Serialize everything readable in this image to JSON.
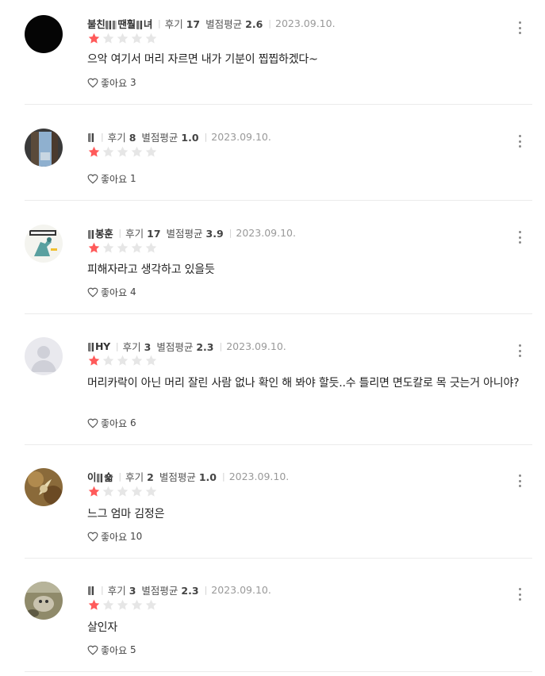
{
  "labels": {
    "review_count_prefix": "후기",
    "rating_avg_prefix": "별점평균",
    "like_prefix": "좋아요"
  },
  "colors": {
    "star_filled": "#ff5a5a",
    "star_empty": "#e6e6e6"
  },
  "reviews": [
    {
      "nickname": "불친",
      "nickname_tail": "땐훨",
      "nickname_end": "녀",
      "review_count": "17",
      "rating_avg": "2.6",
      "date": "2023.09.10.",
      "stars": 1,
      "content": "으악 여기서 머리 자르면 내가 기분이 찝찝하겠다~",
      "likes": "3",
      "avatar": "black-avatar"
    },
    {
      "nickname": "",
      "nickname_tail": "",
      "nickname_end": "",
      "review_count": "8",
      "rating_avg": "1.0",
      "date": "2023.09.10.",
      "stars": 1,
      "content": "",
      "likes": "1",
      "avatar": "window-photo-avatar"
    },
    {
      "nickname": "",
      "nickname_tail": "봉훈",
      "nickname_end": "",
      "review_count": "17",
      "rating_avg": "3.9",
      "date": "2023.09.10.",
      "stars": 1,
      "content": "피해자라고 생각하고 있을듯",
      "likes": "4",
      "avatar": "cartoon-avatar"
    },
    {
      "nickname": "",
      "nickname_tail": "HY",
      "nickname_end": "",
      "review_count": "3",
      "rating_avg": "2.3",
      "date": "2023.09.10.",
      "stars": 1,
      "content": "머리카락이 아닌 머리 잘린 사람 없나 확인 해 봐야 할듯..수 틀리면 면도칼로 목 긋는거 아니야?",
      "likes": "6",
      "avatar": "default-avatar"
    },
    {
      "nickname": "이",
      "nickname_tail": "숇",
      "nickname_end": "",
      "review_count": "2",
      "rating_avg": "1.0",
      "date": "2023.09.10.",
      "stars": 1,
      "content": "느그 엄마 김정은",
      "likes": "10",
      "avatar": "plant-photo-avatar"
    },
    {
      "nickname": "",
      "nickname_tail": "",
      "nickname_end": "",
      "review_count": "3",
      "rating_avg": "2.3",
      "date": "2023.09.10.",
      "stars": 1,
      "content": "살인자",
      "likes": "5",
      "avatar": "animal-photo-avatar"
    }
  ]
}
